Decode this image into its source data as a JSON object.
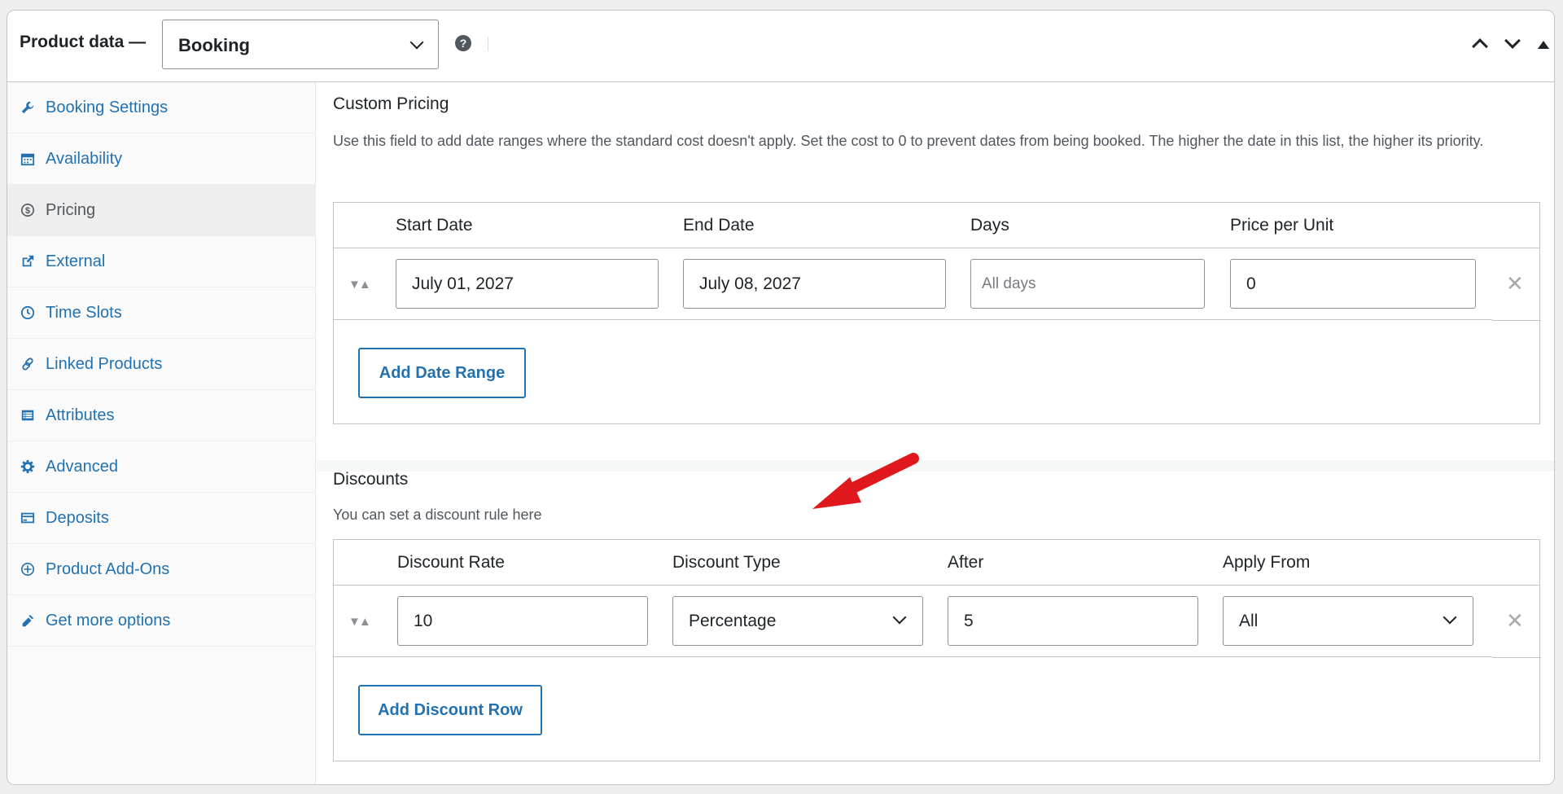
{
  "header": {
    "title": "Product data —",
    "product_type": "Booking",
    "help_symbol": "?"
  },
  "sidebar": {
    "tabs": [
      {
        "label": "Booking Settings",
        "icon": "wrench-icon"
      },
      {
        "label": "Availability",
        "icon": "calendar-icon"
      },
      {
        "label": "Pricing",
        "icon": "dollar-icon",
        "active": true
      },
      {
        "label": "External",
        "icon": "external-link-icon"
      },
      {
        "label": "Time Slots",
        "icon": "clock-icon"
      },
      {
        "label": "Linked Products",
        "icon": "link-icon"
      },
      {
        "label": "Attributes",
        "icon": "list-icon"
      },
      {
        "label": "Advanced",
        "icon": "gear-icon"
      },
      {
        "label": "Deposits",
        "icon": "card-icon"
      },
      {
        "label": "Product Add-Ons",
        "icon": "plus-circle-icon"
      },
      {
        "label": "Get more options",
        "icon": "megaphone-icon"
      }
    ]
  },
  "custom_pricing": {
    "title": "Custom Pricing",
    "description": "Use this field to add date ranges where the standard cost doesn't apply. Set the cost to 0 to prevent dates from being booked. The higher the date in this list, the higher its priority.",
    "columns": {
      "start_date": "Start Date",
      "end_date": "End Date",
      "days": "Days",
      "price": "Price per Unit"
    },
    "row": {
      "start_date": "July 01, 2027",
      "end_date": "July 08, 2027",
      "days_placeholder": "All days",
      "price": "0"
    },
    "add_button": "Add Date Range"
  },
  "discounts": {
    "title": "Discounts",
    "description": "You can set a discount rule here",
    "columns": {
      "rate": "Discount Rate",
      "type": "Discount Type",
      "after": "After",
      "apply_from": "Apply From"
    },
    "row": {
      "rate": "10",
      "type": "Percentage",
      "after": "5",
      "apply_from": "All"
    },
    "add_button": "Add Discount Row"
  },
  "colors": {
    "link": "#2271b1",
    "annotation_arrow": "#e0171c"
  }
}
